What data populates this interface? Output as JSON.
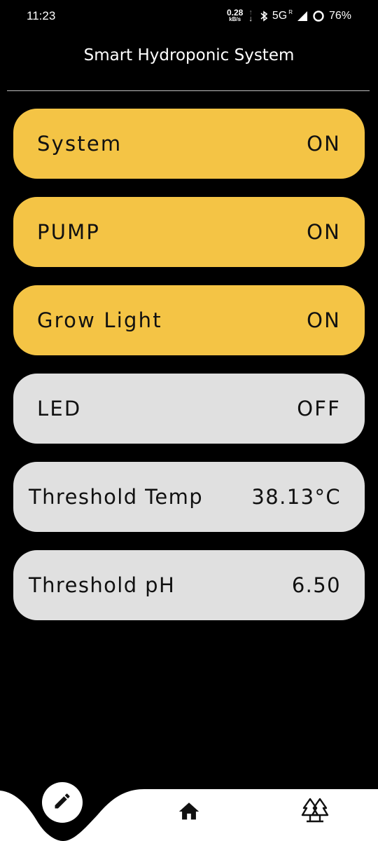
{
  "status_bar": {
    "time": "11:23",
    "net_speed_value": "0.28",
    "net_speed_unit": "kB/s",
    "network_type": "5G",
    "roaming": "R",
    "battery": "76%"
  },
  "header": {
    "title": "Smart Hydroponic System"
  },
  "controls": [
    {
      "label": "System",
      "value": "ON",
      "state": "on"
    },
    {
      "label": "PUMP",
      "value": "ON",
      "state": "on"
    },
    {
      "label": "Grow Light",
      "value": "ON",
      "state": "on"
    },
    {
      "label": "LED",
      "value": "OFF",
      "state": "off"
    }
  ],
  "thresholds": [
    {
      "label": "Threshold Temp",
      "value": "38.13°C"
    },
    {
      "label": "Threshold pH",
      "value": "6.50"
    }
  ],
  "nav": {
    "icons": [
      "pencil-icon",
      "home-icon",
      "trees-icon"
    ]
  },
  "colors": {
    "on": "#f4c445",
    "off": "#e0e0e0",
    "background": "#000000"
  }
}
